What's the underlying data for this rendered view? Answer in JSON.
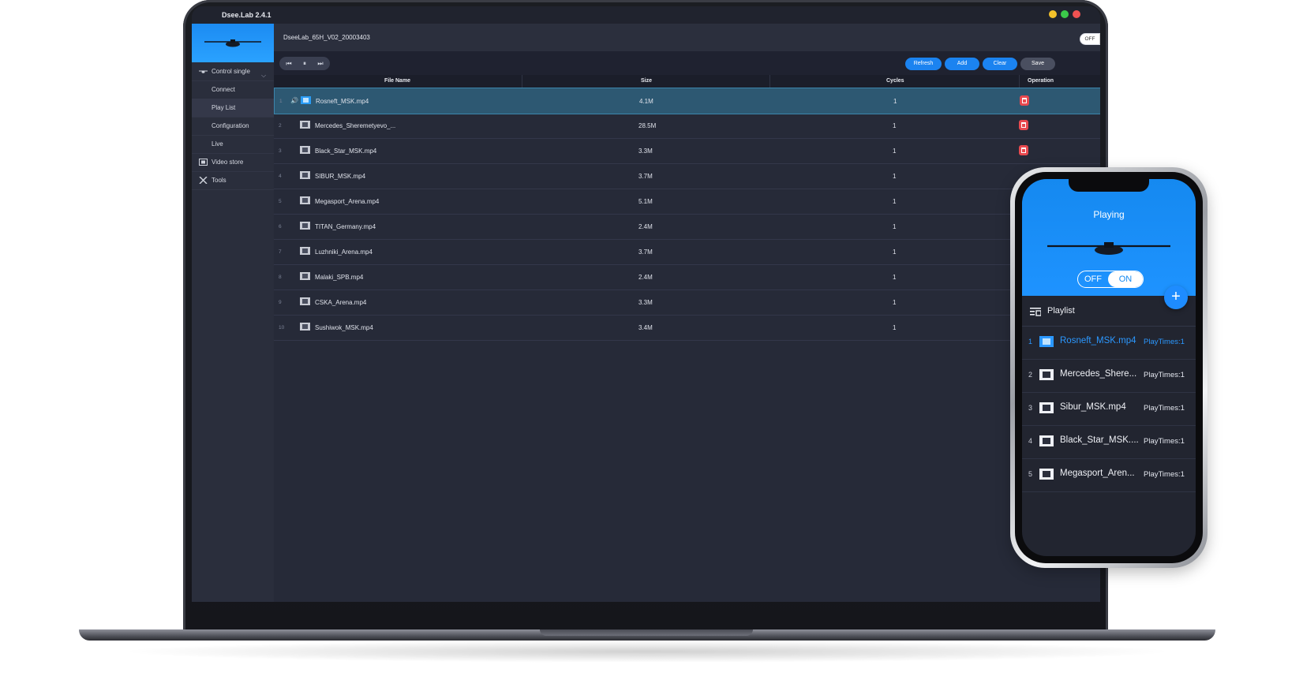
{
  "app": {
    "title": "Dsee.Lab 2.4.1",
    "device_name": "DseeLab_65H_V02_20003403",
    "power_toggle": {
      "off_label": "OFF",
      "on_label": "ON",
      "state": "ON"
    }
  },
  "sidebar": {
    "items": [
      {
        "label": "Control single",
        "icon": "hologram-icon",
        "expanded": true
      },
      {
        "label": "Connect"
      },
      {
        "label": "Play List",
        "active": true
      },
      {
        "label": "Configuration"
      },
      {
        "label": "Live"
      },
      {
        "label": "Video store",
        "icon": "film-icon"
      },
      {
        "label": "Tools",
        "icon": "tools-icon"
      }
    ]
  },
  "toolbar": {
    "prev_icon": "skip-previous-icon",
    "pause_icon": "pause-icon",
    "next_icon": "skip-next-icon",
    "refresh_label": "Refresh",
    "add_label": "Add",
    "clear_label": "Clear",
    "save_label": "Save"
  },
  "table": {
    "columns": [
      "File Name",
      "Size",
      "Cycles",
      "Operation"
    ],
    "rows": [
      {
        "index": "1",
        "name": "Rosneft_MSK.mp4",
        "size": "4.1M",
        "cycles": "1",
        "playing": true
      },
      {
        "index": "2",
        "name": "Mercedes_Sheremetyevo_...",
        "size": "28.5M",
        "cycles": "1"
      },
      {
        "index": "3",
        "name": "Black_Star_MSK.mp4",
        "size": "3.3M",
        "cycles": "1"
      },
      {
        "index": "4",
        "name": "SIBUR_MSK.mp4",
        "size": "3.7M",
        "cycles": "1"
      },
      {
        "index": "5",
        "name": "Megasport_Arena.mp4",
        "size": "5.1M",
        "cycles": "1"
      },
      {
        "index": "6",
        "name": "TITAN_Germany.mp4",
        "size": "2.4M",
        "cycles": "1"
      },
      {
        "index": "7",
        "name": "Luzhniki_Arena.mp4",
        "size": "3.7M",
        "cycles": "1"
      },
      {
        "index": "8",
        "name": "Malaki_SPB.mp4",
        "size": "2.4M",
        "cycles": "1"
      },
      {
        "index": "9",
        "name": "CSKA_Arena.mp4",
        "size": "3.3M",
        "cycles": "1"
      },
      {
        "index": "10",
        "name": "Sushiwok_MSK.mp4",
        "size": "3.4M",
        "cycles": "1"
      }
    ]
  },
  "phone": {
    "status": "Playing",
    "toggle": {
      "off_label": "OFF",
      "on_label": "ON",
      "state": "ON"
    },
    "add_label": "+",
    "playlist_title": "Playlist",
    "items": [
      {
        "index": "1",
        "name": "Rosneft_MSK.mp4",
        "times": "PlayTimes:1",
        "active": true
      },
      {
        "index": "2",
        "name": "Mercedes_Shere...",
        "times": "PlayTimes:1"
      },
      {
        "index": "3",
        "name": "Sibur_MSK.mp4",
        "times": "PlayTimes:1"
      },
      {
        "index": "4",
        "name": "Black_Star_MSK....",
        "times": "PlayTimes:1"
      },
      {
        "index": "5",
        "name": "Megasport_Aren...",
        "times": "PlayTimes:1"
      }
    ]
  },
  "colors": {
    "accent": "#1b83f0",
    "delete": "#e8494f",
    "background": "#262a38"
  }
}
